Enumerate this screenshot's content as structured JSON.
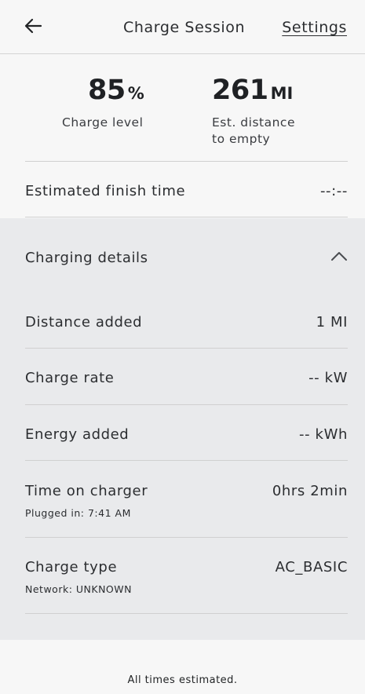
{
  "header": {
    "title": "Charge Session",
    "settings_label": "Settings",
    "back_icon": "arrow-left-icon"
  },
  "summary": {
    "charge_level": {
      "value": "85",
      "unit": "%",
      "label": "Charge level"
    },
    "distance_to_empty": {
      "value": "261",
      "unit": "MI",
      "label_line1": "Est. distance",
      "label_line2": "to empty"
    }
  },
  "finish_time": {
    "label": "Estimated finish time",
    "value": "--:--"
  },
  "details": {
    "title": "Charging details",
    "toggle_icon": "chevron-up-icon",
    "expanded": true,
    "rows": [
      {
        "label": "Distance added",
        "value": "1 MI"
      },
      {
        "label": "Charge rate",
        "value": "-- kW"
      },
      {
        "label": "Energy added",
        "value": "-- kWh"
      },
      {
        "label": "Time on charger",
        "value": "0hrs 2min",
        "sub": "Plugged in: 7:41 AM"
      },
      {
        "label": "Charge type",
        "value": "AC_BASIC",
        "sub": "Network: UNKNOWN"
      }
    ]
  },
  "footer": {
    "note": "All times estimated."
  },
  "colors": {
    "background": "#f7f7f7",
    "details_background": "#e9eaec",
    "text": "#222426",
    "divider": "#d0d0d0"
  }
}
